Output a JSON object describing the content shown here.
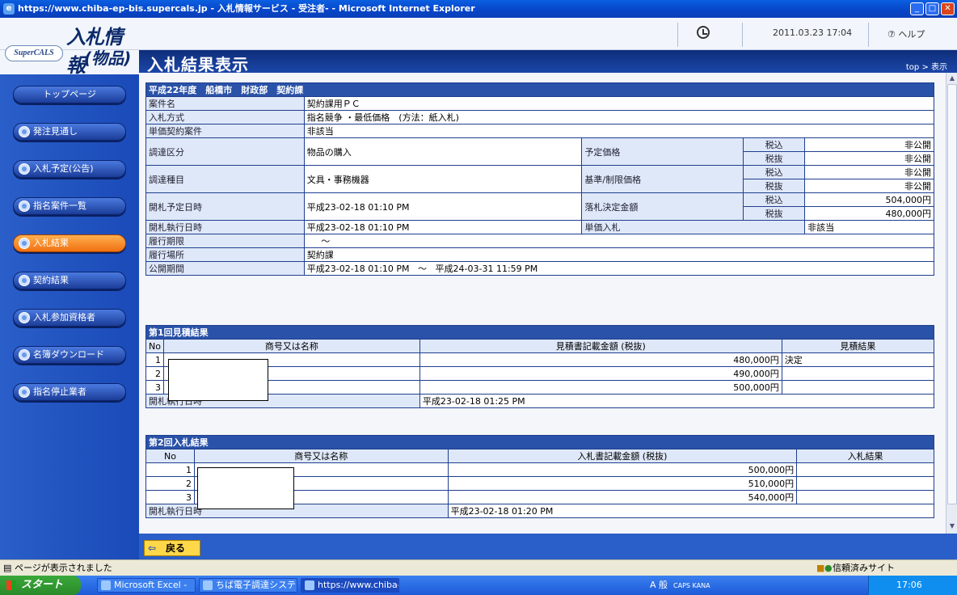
{
  "window": {
    "title": "https://www.chiba-ep-bis.supercals.jp - 入札情報サービス - 受注者- - Microsoft Internet Explorer"
  },
  "logo": {
    "badge": "SuperCALS",
    "line1": "入札情報",
    "line2": "(物品)"
  },
  "header": {
    "datetime": "2011.03.23 17:04",
    "help": "ヘルプ"
  },
  "page": {
    "title": "入札結果表示",
    "breadcrumb": "top > 表示"
  },
  "sidebar": {
    "items": [
      {
        "label": "トップページ"
      },
      {
        "label": "発注見通し"
      },
      {
        "label": "入札予定(公告)"
      },
      {
        "label": "指名案件一覧"
      },
      {
        "label": "入札結果"
      },
      {
        "label": "契約結果"
      },
      {
        "label": "入札参加資格者"
      },
      {
        "label": "名簿ダウンロード"
      },
      {
        "label": "指名停止業者"
      }
    ]
  },
  "summary": {
    "header": "平成22年度　船橋市　財政部　契約課",
    "case_name_label": "案件名",
    "case_name": "契約課用ＰＣ",
    "method_label": "入札方式",
    "method": "指名競争 ・最低価格　(方法：紙入札)",
    "unit_label": "単価契約案件",
    "unit": "非該当",
    "category_label": "調達区分",
    "category": "物品の購入",
    "planned_price_label": "予定価格",
    "tax_in": "税込",
    "tax_ex": "税抜",
    "planned_in": "非公開",
    "planned_ex": "非公開",
    "item_label": "調達種目",
    "item": "文具・事務機器",
    "limit_label": "基準/制限価格",
    "limit_in": "非公開",
    "limit_ex": "非公開",
    "open_plan_label": "開札予定日時",
    "open_plan": "平成23-02-18 01:10 PM",
    "award_label": "落札決定金額",
    "award_in": "504,000円",
    "award_ex": "480,000円",
    "open_exec_label": "開札執行日時",
    "open_exec": "平成23-02-18 01:10 PM",
    "unit_bid_label": "単価入札",
    "unit_bid": "非該当",
    "term_label": "履行期限",
    "term": "～",
    "place_label": "履行場所",
    "place": "契約課",
    "public_label": "公開期間",
    "public_from": "平成23-02-18 01:10 PM",
    "public_tilde": "～",
    "public_to": "平成24-03-31 11:59 PM"
  },
  "round1": {
    "header": "第1回見積結果",
    "col_no": "No",
    "col_name": "商号又は名称",
    "col_amount": "見積書記載金額 (税抜)",
    "col_result": "見積結果",
    "rows": [
      {
        "no": "1",
        "amount": "480,000円",
        "result": "決定"
      },
      {
        "no": "2",
        "amount": "490,000円",
        "result": ""
      },
      {
        "no": "3",
        "amount": "500,000円",
        "result": ""
      }
    ],
    "exec_label": "開札執行日時",
    "exec": "平成23-02-18 01:25 PM"
  },
  "round2": {
    "header": "第2回入札結果",
    "col_no": "No",
    "col_name": "商号又は名称",
    "col_amount": "入札書記載金額 (税抜)",
    "col_result": "入札結果",
    "rows": [
      {
        "no": "1",
        "amount": "500,000円",
        "result": ""
      },
      {
        "no": "2",
        "amount": "510,000円",
        "result": ""
      },
      {
        "no": "3",
        "amount": "540,000円",
        "result": ""
      }
    ],
    "exec_label": "開札執行日時",
    "exec": "平成23-02-18 01:20 PM"
  },
  "back": {
    "label": "戻る"
  },
  "status": {
    "message": "ページが表示されました",
    "zone": "信頼済みサイト"
  },
  "taskbar": {
    "start": "スタート",
    "tasks": [
      "Microsoft Excel - 受...",
      "ちば電子調達システム...",
      "https://www.chiba-e..."
    ],
    "ime": "A 般",
    "caps": "CAPS KANA",
    "clock": "17:06"
  }
}
